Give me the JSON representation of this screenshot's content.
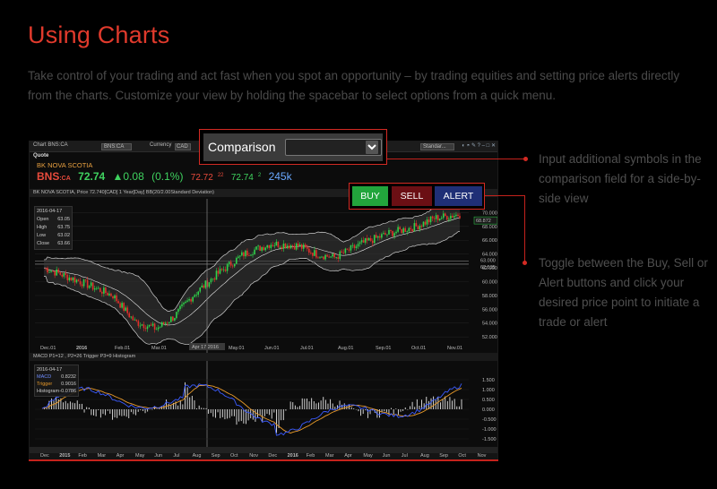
{
  "page": {
    "title": "Using Charts",
    "intro": "Take control of your trading and act fast when you spot an opportunity – by trading equities and setting price alerts directly from the charts. Customize your view by holding the spacebar to select options from a quick menu."
  },
  "titlebar": {
    "window_title": "Chart BNS:CA",
    "symbol_field": "BNS:CA",
    "currency_label": "Currency",
    "currency_value": "CAD",
    "template_value": "Standar..."
  },
  "quote": {
    "label": "Quote",
    "company": "BK NOVA SCOTIA",
    "symbol": "BNS",
    "exchange": ":CA",
    "last": "72.74",
    "change": "▲0.08",
    "pct_change": "(0.1%)",
    "bid": "72.72",
    "bid_size": "22",
    "ask": "72.74",
    "ask_size": "2",
    "volume": "245k"
  },
  "chart": {
    "header": "BK NOVA SCOTIA, Price 72.740[CAD] 1 Year[Day]   BB(20/2.00Standard Deviation)",
    "price_info": {
      "date": "2016-04-17",
      "rows": [
        {
          "label": "Open",
          "value": "63.05"
        },
        {
          "label": "High",
          "value": "63.75"
        },
        {
          "label": "Low",
          "value": "63.02"
        },
        {
          "label": "Close",
          "value": "63.66"
        }
      ]
    },
    "y_ticks": [
      "70.000",
      "68.000",
      "66.000",
      "64.000",
      "62.000",
      "60.000",
      "58.000",
      "56.000",
      "54.000",
      "52.000"
    ],
    "last_price_label": "68.872",
    "level_labels": [
      "63.000",
      "62.535"
    ],
    "x_ticks": [
      "Dec.01",
      "2016",
      "Feb.01",
      "Mar.01",
      "May.01",
      "Jun.01",
      "Jul.01",
      "Aug.01",
      "Sep.01",
      "Oct.01",
      "Nov.01"
    ],
    "crosshair_date": "Apr 17 2016"
  },
  "macd": {
    "header": "MACD P1=12 , P2=26   Trigger P3=9   Histogram",
    "info": {
      "date": "2016-04-17",
      "rows": [
        {
          "label": "MACD",
          "value": "0.8232"
        },
        {
          "label": "Trigger",
          "value": "0.9016"
        },
        {
          "label": "Histogram",
          "value": "-0.0786"
        }
      ]
    },
    "y_ticks": [
      "1.500",
      "1.000",
      "0.500",
      "0.000",
      "-0.500",
      "-1.000",
      "-1.500"
    ],
    "x_ticks": [
      "Dec",
      "2015",
      "Feb",
      "Mar",
      "Apr",
      "May",
      "Jun",
      "Jul",
      "Aug",
      "Sep",
      "Oct",
      "Nov",
      "Dec",
      "2016",
      "Feb",
      "Mar",
      "Apr",
      "May",
      "Jun",
      "Jul",
      "Aug",
      "Sep",
      "Oct",
      "Nov"
    ]
  },
  "comparison": {
    "label": "Comparison",
    "value": ""
  },
  "trade_buttons": {
    "buy": "BUY",
    "sell": "SELL",
    "alert": "ALERT"
  },
  "callouts": {
    "comparison": "Input additional symbols in the comparison field for a side-by-side view",
    "trade": "Toggle between the Buy, Sell or Alert buttons and click your desired price point to initiate a trade or alert"
  },
  "colors": {
    "accent": "#e03a2c",
    "up_candle": "#2fd24a",
    "down_candle": "#e0302a",
    "macd_line": "#3b5bff",
    "trigger_line": "#e89a2a",
    "buy": "#22a53c",
    "sell": "#6b0f14",
    "alert": "#1f2f76"
  }
}
